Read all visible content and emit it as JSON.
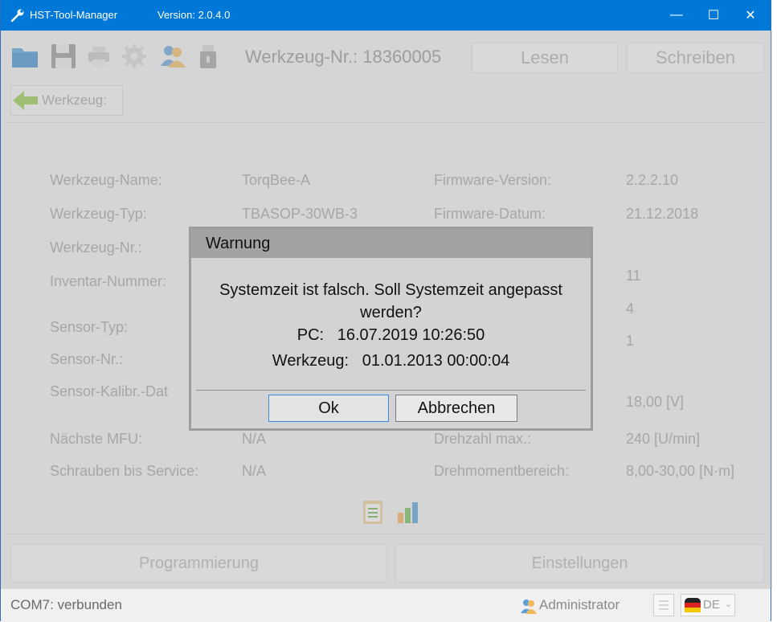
{
  "titlebar": {
    "app_name": "HST-Tool-Manager",
    "version": "Version: 2.0.4.0",
    "minimize": "—",
    "maximize": "☐",
    "close": "✕"
  },
  "toolbar": {
    "tool_number": "Werkzeug-Nr.: 18360005",
    "read_label": "Lesen",
    "write_label": "Schreiben",
    "icons": [
      "folder-icon",
      "save-icon",
      "print-icon",
      "settings-icon",
      "users-icon",
      "usb-drive-icon"
    ]
  },
  "nav": {
    "back_label": "Werkzeug:"
  },
  "info": {
    "left": [
      {
        "label": "Werkzeug-Name:",
        "value": "TorqBee-A"
      },
      {
        "label": "Werkzeug-Typ:",
        "value": "TBASOP-30WB-3"
      },
      {
        "label": "Werkzeug-Nr.:",
        "value": ""
      },
      {
        "label": "Inventar-Nummer:",
        "value": ""
      },
      {
        "label": "Sensor-Typ:",
        "value": ""
      },
      {
        "label": "Sensor-Nr.:",
        "value": ""
      },
      {
        "label": "Sensor-Kalibr.-Dat",
        "value": ""
      },
      {
        "label": "Nächste MFU:",
        "value": "N/A"
      },
      {
        "label": "Schrauben bis Service:",
        "value": "N/A"
      }
    ],
    "right": [
      {
        "label": "Firmware-Version:",
        "value": "2.2.2.10"
      },
      {
        "label": "Firmware-Datum:",
        "value": "21.12.2018"
      },
      {
        "label": "",
        "value": "11"
      },
      {
        "label": "",
        "value": "4"
      },
      {
        "label": "",
        "value": "1"
      },
      {
        "label": "",
        "value": "18,00 [V]"
      },
      {
        "label": "Drehzahl max.:",
        "value": "240 [U/min]"
      },
      {
        "label": "Drehmomentbereich:",
        "value": "8,00-30,00 [N·m]"
      }
    ]
  },
  "bottom": {
    "programming_label": "Programmierung",
    "settings_label": "Einstellungen"
  },
  "status": {
    "connection": "COM7: verbunden",
    "user": "Administrator",
    "language": "DE"
  },
  "dialog": {
    "title": "Warnung",
    "message_line1": "Systemzeit ist falsch. Soll Systemzeit angepasst",
    "message_line2": "werden?",
    "pc_time": "PC:   16.07.2019 10:26:50",
    "tool_time": "Werkzeug:   01.01.2013 00:00:04",
    "ok_label": "Ok",
    "cancel_label": "Abbrechen"
  },
  "colors": {
    "titlebar": "#0078d7",
    "dialog_bg": "#d3d3d3",
    "dialog_title_bg": "#a3a3a3",
    "ok_border": "#3c8be0"
  }
}
